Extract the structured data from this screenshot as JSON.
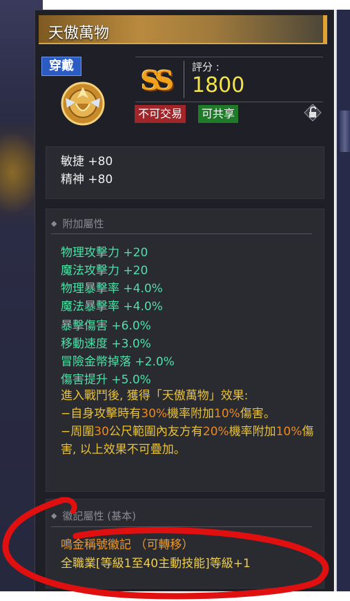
{
  "item": {
    "title": "天傲萬物",
    "badge": "穿戴",
    "rank": "SS",
    "score_label": "評分 :",
    "score_value": "1800",
    "tags": [
      "不可交易",
      "可共享"
    ]
  },
  "base_stats": [
    "敏捷 +80",
    "精神 +80"
  ],
  "additional": {
    "header": "附加屬性",
    "attributes": [
      "物理攻擊力 +20",
      "魔法攻擊力 +20",
      "物理暴擊率 +4.0%",
      "魔法暴擊率 +4.0%",
      "暴擊傷害 +6.0%",
      "移動速度 +3.0%",
      "冒險金幣掉落 +2.0%",
      "傷害提升 +5.0%"
    ],
    "effect_intro": "進入戰鬥後, 獲得「天傲萬物」效果:",
    "effect_line1_a": "  −自身攻擊時有",
    "effect_line1_b": "30%",
    "effect_line1_c": "機率附加",
    "effect_line1_d": "10%",
    "effect_line1_e": "傷害。",
    "effect_line2_a": "  −周圍",
    "effect_line2_b": "30",
    "effect_line2_c": "公尺範圍內友方有",
    "effect_line2_d": "20%",
    "effect_line2_e": "機率附加",
    "effect_line2_f": "10%",
    "effect_line2_g": "傷害, 以上效果不可疊加。"
  },
  "insignia": {
    "header": "徽記屬性 (基本)",
    "name": "鳴金稱號徽記 （可轉移）",
    "bonus": "全職業[等級1至40主動技能]等級+1"
  },
  "colors": {
    "attr_green": "#4fe0a8",
    "effect_yellow": "#e8c23a",
    "highlight_orange": "#f08a1a",
    "annotation_red": "#e01010"
  }
}
